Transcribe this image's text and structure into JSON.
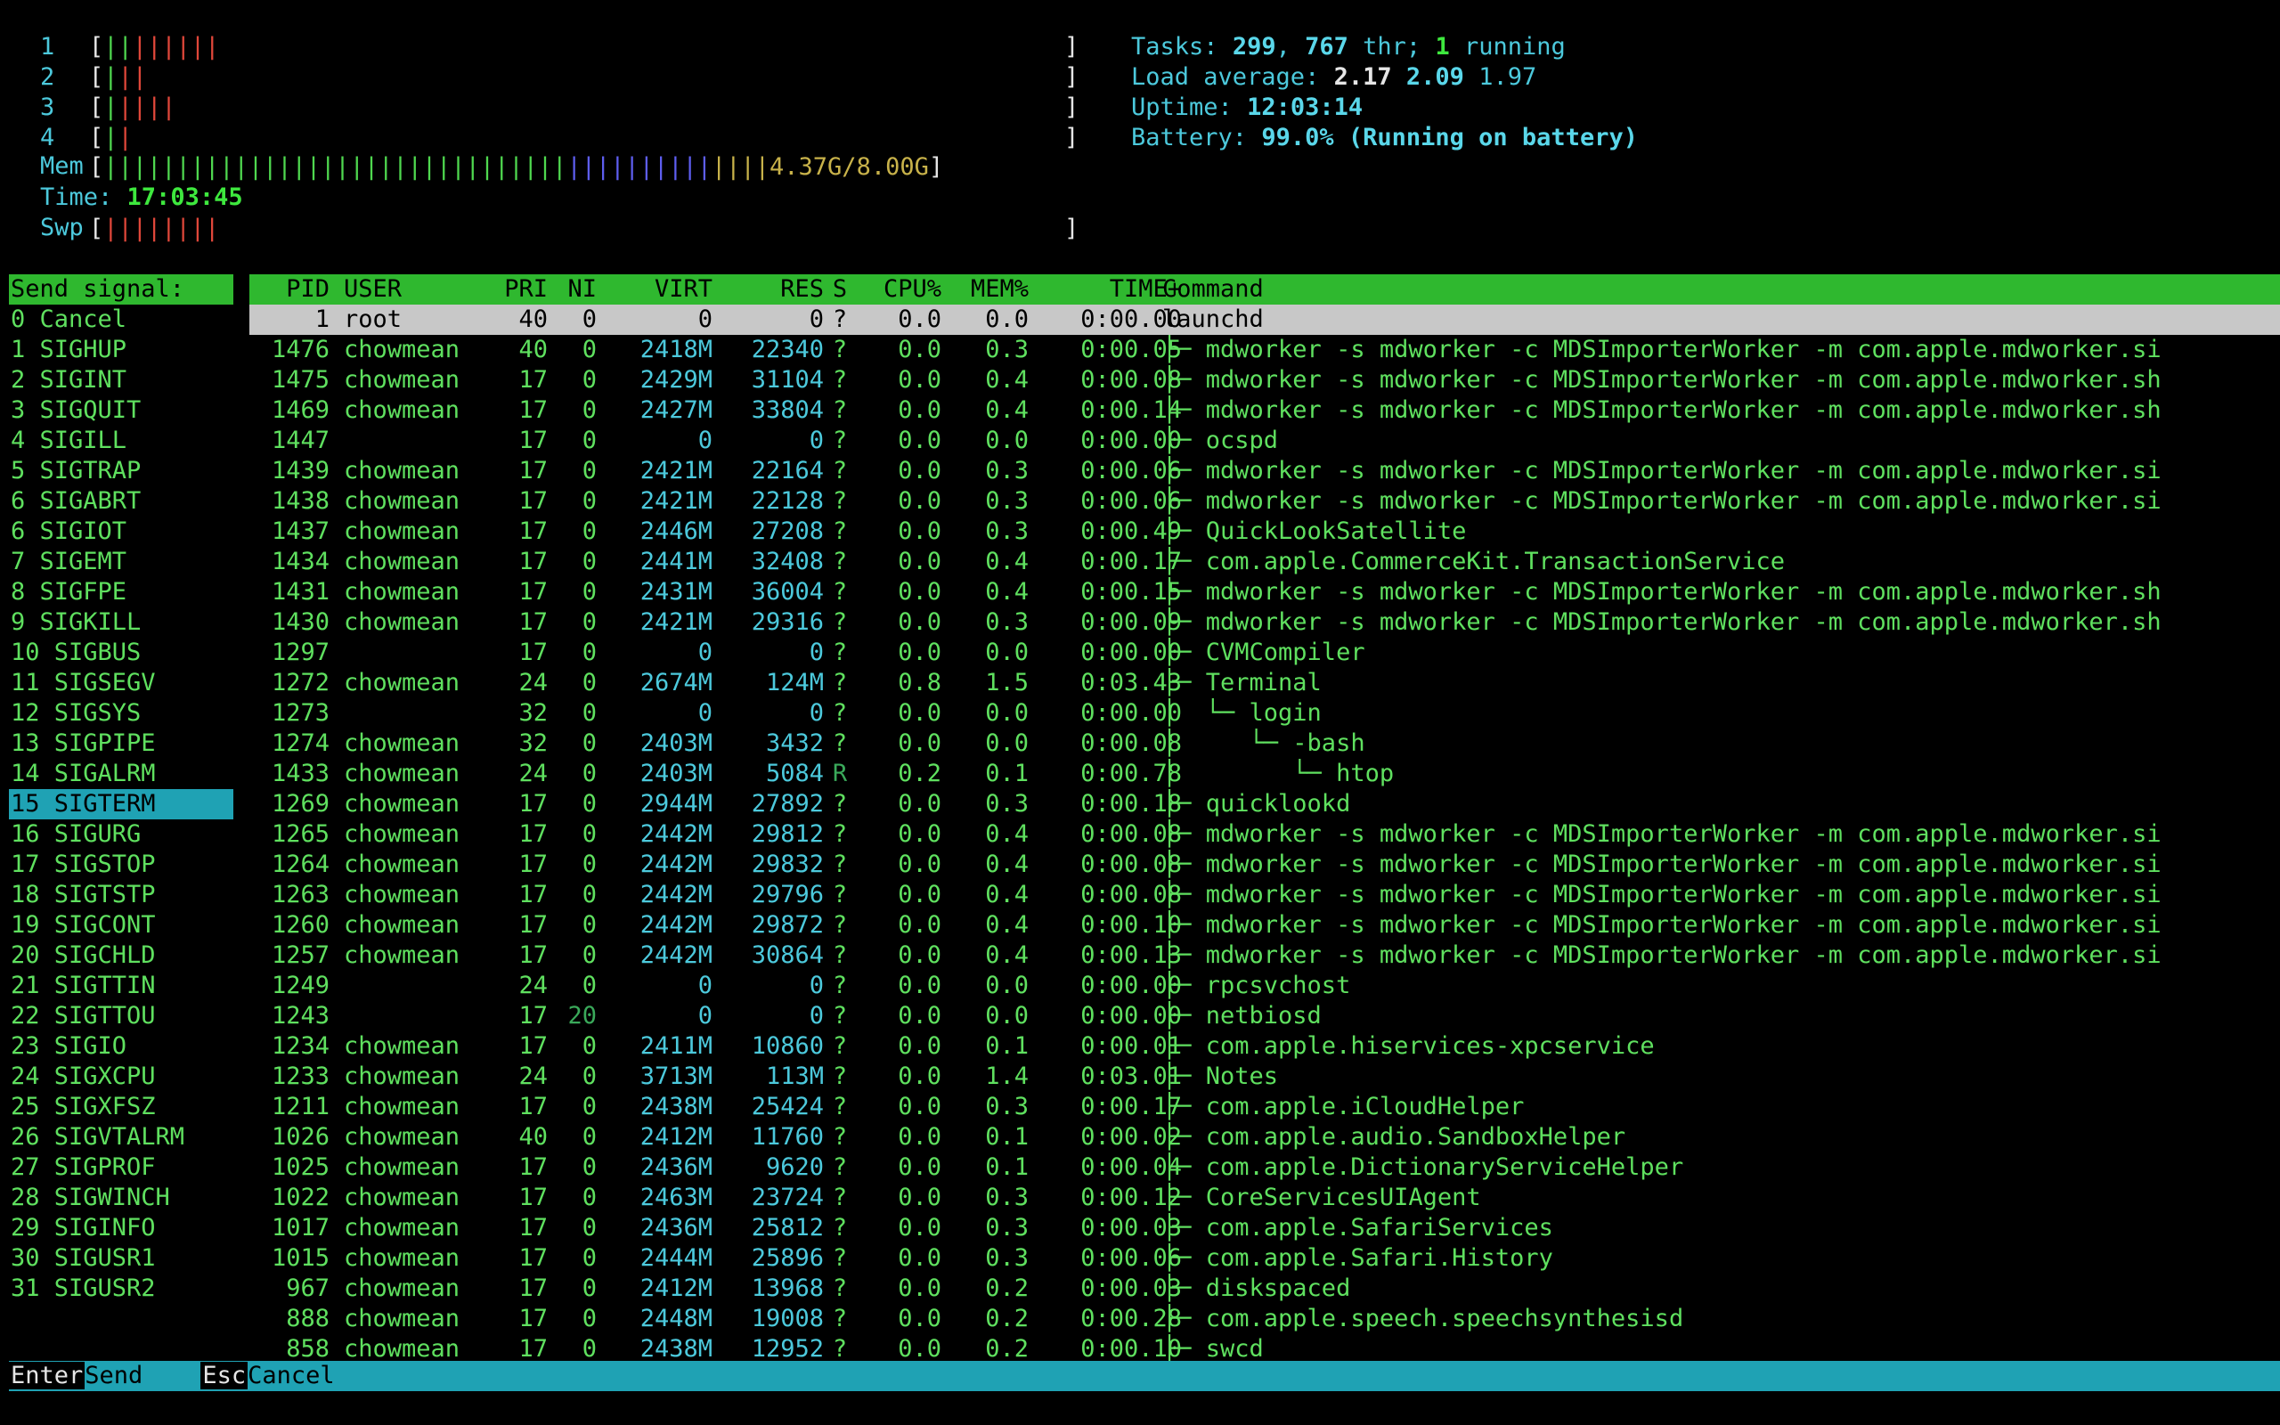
{
  "header": {
    "cpus": [
      {
        "label": "1",
        "bars": "||||||||",
        "colors": [
          "grn",
          "grn",
          "red",
          "red",
          "red",
          "red",
          "red",
          "red"
        ]
      },
      {
        "label": "2",
        "bars": "|||",
        "colors": [
          "grn",
          "red",
          "red"
        ]
      },
      {
        "label": "3",
        "bars": "|||||",
        "colors": [
          "grn",
          "red",
          "red",
          "red",
          "red"
        ]
      },
      {
        "label": "4",
        "bars": "||",
        "colors": [
          "grn",
          "red"
        ]
      }
    ],
    "mem_label": "Mem",
    "mem_value": "4.37G/8.00G",
    "time_label": "Time:",
    "time_value": "17:03:45",
    "swp_label": "Swp",
    "swp_bars": "||||||||",
    "tasks_label": "Tasks:",
    "tasks_count": "299",
    "threads_count": "767",
    "threads_label": "thr;",
    "running_count": "1",
    "running_label": "running",
    "load_label": "Load average:",
    "load_1": "2.17",
    "load_5": "2.09",
    "load_15": "1.97",
    "uptime_label": "Uptime:",
    "uptime_value": "12:03:14",
    "battery_label": "Battery:",
    "battery_value": "99.0%",
    "battery_status": "(Running on battery)"
  },
  "signals": {
    "title": "Send signal:",
    "selected_index": 15,
    "items": [
      "0 Cancel",
      "1 SIGHUP",
      "2 SIGINT",
      "3 SIGQUIT",
      "4 SIGILL",
      "5 SIGTRAP",
      "6 SIGABRT",
      "6 SIGIOT",
      "7 SIGEMT",
      "8 SIGFPE",
      "9 SIGKILL",
      "10 SIGBUS",
      "11 SIGSEGV",
      "12 SIGSYS",
      "13 SIGPIPE",
      "14 SIGALRM",
      "15 SIGTERM",
      "16 SIGURG",
      "17 SIGSTOP",
      "18 SIGTSTP",
      "19 SIGCONT",
      "20 SIGCHLD",
      "21 SIGTTIN",
      "22 SIGTTOU",
      "23 SIGIO",
      "24 SIGXCPU",
      "25 SIGXFSZ",
      "26 SIGVTALRM",
      "27 SIGPROF",
      "28 SIGWINCH",
      "29 SIGINFO",
      "30 SIGUSR1",
      "31 SIGUSR2"
    ]
  },
  "table": {
    "columns": {
      "pid": "PID",
      "user": "USER",
      "pri": "PRI",
      "ni": "NI",
      "virt": "VIRT",
      "res": "RES",
      "s": "S",
      "cpu": "CPU%",
      "mem": "MEM%",
      "time": "TIME+",
      "cmd": "Command"
    },
    "rows": [
      {
        "pid": "1",
        "user": "root",
        "pri": "40",
        "ni": "0",
        "virt": "0",
        "res": "0",
        "s": "?",
        "cpu": "0.0",
        "mem": "0.0",
        "time": "0:00.00",
        "cmd": "launchd"
      },
      {
        "pid": "1476",
        "user": "chowmean",
        "pri": "40",
        "ni": "0",
        "virt": "2418M",
        "res": "22340",
        "s": "?",
        "cpu": "0.0",
        "mem": "0.3",
        "time": "0:00.05",
        "cmd": "├─ mdworker -s mdworker -c MDSImporterWorker -m com.apple.mdworker.si"
      },
      {
        "pid": "1475",
        "user": "chowmean",
        "pri": "17",
        "ni": "0",
        "virt": "2429M",
        "res": "31104",
        "s": "?",
        "cpu": "0.0",
        "mem": "0.4",
        "time": "0:00.08",
        "cmd": "├─ mdworker -s mdworker -c MDSImporterWorker -m com.apple.mdworker.sh"
      },
      {
        "pid": "1469",
        "user": "chowmean",
        "pri": "17",
        "ni": "0",
        "virt": "2427M",
        "res": "33804",
        "s": "?",
        "cpu": "0.0",
        "mem": "0.4",
        "time": "0:00.14",
        "cmd": "├─ mdworker -s mdworker -c MDSImporterWorker -m com.apple.mdworker.sh"
      },
      {
        "pid": "1447",
        "user": "",
        "pri": "17",
        "ni": "0",
        "virt": "0",
        "res": "0",
        "s": "?",
        "cpu": "0.0",
        "mem": "0.0",
        "time": "0:00.00",
        "cmd": "├─ ocspd"
      },
      {
        "pid": "1439",
        "user": "chowmean",
        "pri": "17",
        "ni": "0",
        "virt": "2421M",
        "res": "22164",
        "s": "?",
        "cpu": "0.0",
        "mem": "0.3",
        "time": "0:00.06",
        "cmd": "├─ mdworker -s mdworker -c MDSImporterWorker -m com.apple.mdworker.si"
      },
      {
        "pid": "1438",
        "user": "chowmean",
        "pri": "17",
        "ni": "0",
        "virt": "2421M",
        "res": "22128",
        "s": "?",
        "cpu": "0.0",
        "mem": "0.3",
        "time": "0:00.06",
        "cmd": "├─ mdworker -s mdworker -c MDSImporterWorker -m com.apple.mdworker.si"
      },
      {
        "pid": "1437",
        "user": "chowmean",
        "pri": "17",
        "ni": "0",
        "virt": "2446M",
        "res": "27208",
        "s": "?",
        "cpu": "0.0",
        "mem": "0.3",
        "time": "0:00.49",
        "cmd": "├─ QuickLookSatellite"
      },
      {
        "pid": "1434",
        "user": "chowmean",
        "pri": "17",
        "ni": "0",
        "virt": "2441M",
        "res": "32408",
        "s": "?",
        "cpu": "0.0",
        "mem": "0.4",
        "time": "0:00.17",
        "cmd": "├─ com.apple.CommerceKit.TransactionService"
      },
      {
        "pid": "1431",
        "user": "chowmean",
        "pri": "17",
        "ni": "0",
        "virt": "2431M",
        "res": "36004",
        "s": "?",
        "cpu": "0.0",
        "mem": "0.4",
        "time": "0:00.15",
        "cmd": "├─ mdworker -s mdworker -c MDSImporterWorker -m com.apple.mdworker.sh"
      },
      {
        "pid": "1430",
        "user": "chowmean",
        "pri": "17",
        "ni": "0",
        "virt": "2421M",
        "res": "29316",
        "s": "?",
        "cpu": "0.0",
        "mem": "0.3",
        "time": "0:00.09",
        "cmd": "├─ mdworker -s mdworker -c MDSImporterWorker -m com.apple.mdworker.sh"
      },
      {
        "pid": "1297",
        "user": "",
        "pri": "17",
        "ni": "0",
        "virt": "0",
        "res": "0",
        "s": "?",
        "cpu": "0.0",
        "mem": "0.0",
        "time": "0:00.00",
        "cmd": "├─ CVMCompiler"
      },
      {
        "pid": "1272",
        "user": "chowmean",
        "pri": "24",
        "ni": "0",
        "virt": "2674M",
        "res": "124M",
        "s": "?",
        "cpu": "0.8",
        "mem": "1.5",
        "time": "0:03.43",
        "cmd": "├─ Terminal"
      },
      {
        "pid": "1273",
        "user": "",
        "pri": "32",
        "ni": "0",
        "virt": "0",
        "res": "0",
        "s": "?",
        "cpu": "0.0",
        "mem": "0.0",
        "time": "0:00.00",
        "cmd": "│  └─ login"
      },
      {
        "pid": "1274",
        "user": "chowmean",
        "pri": "32",
        "ni": "0",
        "virt": "2403M",
        "res": "3432",
        "s": "?",
        "cpu": "0.0",
        "mem": "0.0",
        "time": "0:00.08",
        "cmd": "│     └─ -bash"
      },
      {
        "pid": "1433",
        "user": "chowmean",
        "pri": "24",
        "ni": "0",
        "virt": "2403M",
        "res": "5084",
        "s": "R",
        "cpu": "0.2",
        "mem": "0.1",
        "time": "0:00.78",
        "cmd": "│        └─ htop"
      },
      {
        "pid": "1269",
        "user": "chowmean",
        "pri": "17",
        "ni": "0",
        "virt": "2944M",
        "res": "27892",
        "s": "?",
        "cpu": "0.0",
        "mem": "0.3",
        "time": "0:00.18",
        "cmd": "├─ quicklookd"
      },
      {
        "pid": "1265",
        "user": "chowmean",
        "pri": "17",
        "ni": "0",
        "virt": "2442M",
        "res": "29812",
        "s": "?",
        "cpu": "0.0",
        "mem": "0.4",
        "time": "0:00.08",
        "cmd": "├─ mdworker -s mdworker -c MDSImporterWorker -m com.apple.mdworker.si"
      },
      {
        "pid": "1264",
        "user": "chowmean",
        "pri": "17",
        "ni": "0",
        "virt": "2442M",
        "res": "29832",
        "s": "?",
        "cpu": "0.0",
        "mem": "0.4",
        "time": "0:00.08",
        "cmd": "├─ mdworker -s mdworker -c MDSImporterWorker -m com.apple.mdworker.si"
      },
      {
        "pid": "1263",
        "user": "chowmean",
        "pri": "17",
        "ni": "0",
        "virt": "2442M",
        "res": "29796",
        "s": "?",
        "cpu": "0.0",
        "mem": "0.4",
        "time": "0:00.08",
        "cmd": "├─ mdworker -s mdworker -c MDSImporterWorker -m com.apple.mdworker.si"
      },
      {
        "pid": "1260",
        "user": "chowmean",
        "pri": "17",
        "ni": "0",
        "virt": "2442M",
        "res": "29872",
        "s": "?",
        "cpu": "0.0",
        "mem": "0.4",
        "time": "0:00.10",
        "cmd": "├─ mdworker -s mdworker -c MDSImporterWorker -m com.apple.mdworker.si"
      },
      {
        "pid": "1257",
        "user": "chowmean",
        "pri": "17",
        "ni": "0",
        "virt": "2442M",
        "res": "30864",
        "s": "?",
        "cpu": "0.0",
        "mem": "0.4",
        "time": "0:00.13",
        "cmd": "├─ mdworker -s mdworker -c MDSImporterWorker -m com.apple.mdworker.si"
      },
      {
        "pid": "1249",
        "user": "",
        "pri": "24",
        "ni": "0",
        "virt": "0",
        "res": "0",
        "s": "?",
        "cpu": "0.0",
        "mem": "0.0",
        "time": "0:00.00",
        "cmd": "├─ rpcsvchost"
      },
      {
        "pid": "1243",
        "user": "",
        "pri": "17",
        "ni": "20",
        "virt": "0",
        "res": "0",
        "s": "?",
        "cpu": "0.0",
        "mem": "0.0",
        "time": "0:00.00",
        "cmd": "├─ netbiosd"
      },
      {
        "pid": "1234",
        "user": "chowmean",
        "pri": "17",
        "ni": "0",
        "virt": "2411M",
        "res": "10860",
        "s": "?",
        "cpu": "0.0",
        "mem": "0.1",
        "time": "0:00.01",
        "cmd": "├─ com.apple.hiservices-xpcservice"
      },
      {
        "pid": "1233",
        "user": "chowmean",
        "pri": "24",
        "ni": "0",
        "virt": "3713M",
        "res": "113M",
        "s": "?",
        "cpu": "0.0",
        "mem": "1.4",
        "time": "0:03.01",
        "cmd": "├─ Notes"
      },
      {
        "pid": "1211",
        "user": "chowmean",
        "pri": "17",
        "ni": "0",
        "virt": "2438M",
        "res": "25424",
        "s": "?",
        "cpu": "0.0",
        "mem": "0.3",
        "time": "0:00.17",
        "cmd": "├─ com.apple.iCloudHelper"
      },
      {
        "pid": "1026",
        "user": "chowmean",
        "pri": "40",
        "ni": "0",
        "virt": "2412M",
        "res": "11760",
        "s": "?",
        "cpu": "0.0",
        "mem": "0.1",
        "time": "0:00.02",
        "cmd": "├─ com.apple.audio.SandboxHelper"
      },
      {
        "pid": "1025",
        "user": "chowmean",
        "pri": "17",
        "ni": "0",
        "virt": "2436M",
        "res": "9620",
        "s": "?",
        "cpu": "0.0",
        "mem": "0.1",
        "time": "0:00.04",
        "cmd": "├─ com.apple.DictionaryServiceHelper"
      },
      {
        "pid": "1022",
        "user": "chowmean",
        "pri": "17",
        "ni": "0",
        "virt": "2463M",
        "res": "23724",
        "s": "?",
        "cpu": "0.0",
        "mem": "0.3",
        "time": "0:00.12",
        "cmd": "├─ CoreServicesUIAgent"
      },
      {
        "pid": "1017",
        "user": "chowmean",
        "pri": "17",
        "ni": "0",
        "virt": "2436M",
        "res": "25812",
        "s": "?",
        "cpu": "0.0",
        "mem": "0.3",
        "time": "0:00.03",
        "cmd": "├─ com.apple.SafariServices"
      },
      {
        "pid": "1015",
        "user": "chowmean",
        "pri": "17",
        "ni": "0",
        "virt": "2444M",
        "res": "25896",
        "s": "?",
        "cpu": "0.0",
        "mem": "0.3",
        "time": "0:00.06",
        "cmd": "├─ com.apple.Safari.History"
      },
      {
        "pid": "967",
        "user": "chowmean",
        "pri": "17",
        "ni": "0",
        "virt": "2412M",
        "res": "13968",
        "s": "?",
        "cpu": "0.0",
        "mem": "0.2",
        "time": "0:00.03",
        "cmd": "├─ diskspaced"
      },
      {
        "pid": "888",
        "user": "chowmean",
        "pri": "17",
        "ni": "0",
        "virt": "2448M",
        "res": "19008",
        "s": "?",
        "cpu": "0.0",
        "mem": "0.2",
        "time": "0:00.28",
        "cmd": "├─ com.apple.speech.speechsynthesisd"
      },
      {
        "pid": "858",
        "user": "chowmean",
        "pri": "17",
        "ni": "0",
        "virt": "2438M",
        "res": "12952",
        "s": "?",
        "cpu": "0.0",
        "mem": "0.2",
        "time": "0:00.10",
        "cmd": "├─ swcd"
      }
    ]
  },
  "footer": {
    "enter_key": "Enter",
    "enter_label": "Send",
    "esc_key": "Esc",
    "esc_label": "Cancel"
  }
}
